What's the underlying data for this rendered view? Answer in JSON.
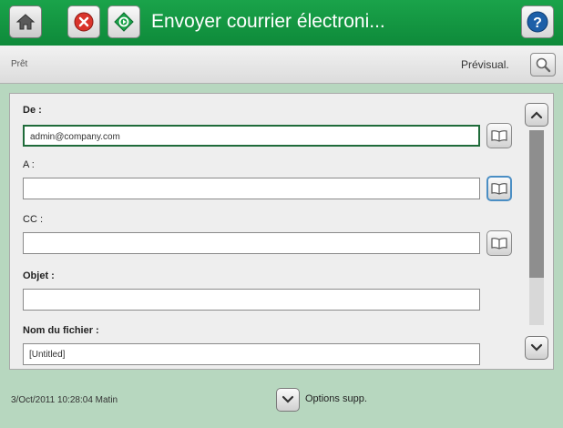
{
  "header": {
    "title": "Envoyer courrier électroni...",
    "icons": [
      "home-icon",
      "stop-icon",
      "start-icon",
      "help-icon"
    ],
    "help_glyph": "?"
  },
  "status": {
    "text": "Prêt",
    "preview_label": "Prévisual."
  },
  "form": {
    "from_label": "De :",
    "from_value": "admin@company.com",
    "to_label": "A :",
    "to_value": "",
    "cc_label": "CC :",
    "cc_value": "",
    "subject_label": "Objet :",
    "subject_value": "",
    "filename_label": "Nom du fichier :",
    "filename_value": "[Untitled]"
  },
  "footer": {
    "datetime": "3/Oct/2011 10:28:04 Matin",
    "options_label": "Options supp."
  },
  "colors": {
    "titlebar": "#14994a",
    "main_bg": "#b7d7bf",
    "focus_border": "#1f6b3a",
    "active_border": "#4a8ec4",
    "stop_red": "#d9342b"
  }
}
